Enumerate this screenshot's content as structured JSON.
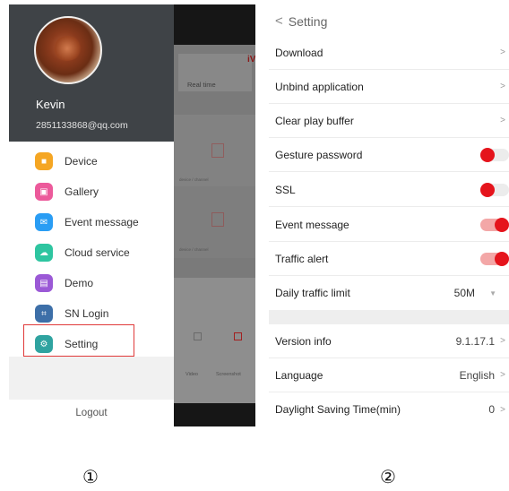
{
  "left_panel": {
    "user": {
      "name": "Kevin",
      "email": "2851133868@qq.com"
    },
    "menu": [
      {
        "label": "Device",
        "icon": "device-icon",
        "color": "#f5a623",
        "glyph": "■"
      },
      {
        "label": "Gallery",
        "icon": "gallery-icon",
        "color": "#ec5a9b",
        "glyph": "▣"
      },
      {
        "label": "Event message",
        "icon": "event-message-icon",
        "color": "#2a9df4",
        "glyph": "✉"
      },
      {
        "label": "Cloud service",
        "icon": "cloud-icon",
        "color": "#2ec5a0",
        "glyph": "☁"
      },
      {
        "label": "Demo",
        "icon": "demo-icon",
        "color": "#9b59d6",
        "glyph": "▤"
      },
      {
        "label": "SN Login",
        "icon": "sn-login-icon",
        "color": "#3d6fa8",
        "glyph": "⌗"
      },
      {
        "label": "Setting",
        "icon": "setting-icon",
        "color": "#2fa3a0",
        "glyph": "⚙"
      }
    ],
    "logout": "Logout",
    "highlight_color": "#e03a3a"
  },
  "background_app": {
    "tab_label": "Real time",
    "brand_fragment": "iV",
    "channel_label_1": "device / channel",
    "channel_label_2": "device / channel",
    "footer_video": "Video",
    "footer_screenshot": "Screenshot"
  },
  "right_panel": {
    "title": "Setting",
    "rows": {
      "download": "Download",
      "unbind": "Unbind application",
      "clear_buffer": "Clear play buffer",
      "gesture": "Gesture password",
      "ssl": "SSL",
      "event_message": "Event message",
      "traffic_alert": "Traffic alert",
      "daily_limit": "Daily traffic limit",
      "daily_limit_value": "50M",
      "version": "Version info",
      "version_value": "9.1.17.1",
      "language": "Language",
      "language_value": "English",
      "dst": "Daylight Saving Time(min)",
      "dst_value": "0"
    },
    "toggles": {
      "gesture": false,
      "ssl": false,
      "event_message": true,
      "traffic_alert": true
    },
    "accent_color": "#e5141c"
  },
  "captions": {
    "left": "①",
    "right": "②"
  }
}
